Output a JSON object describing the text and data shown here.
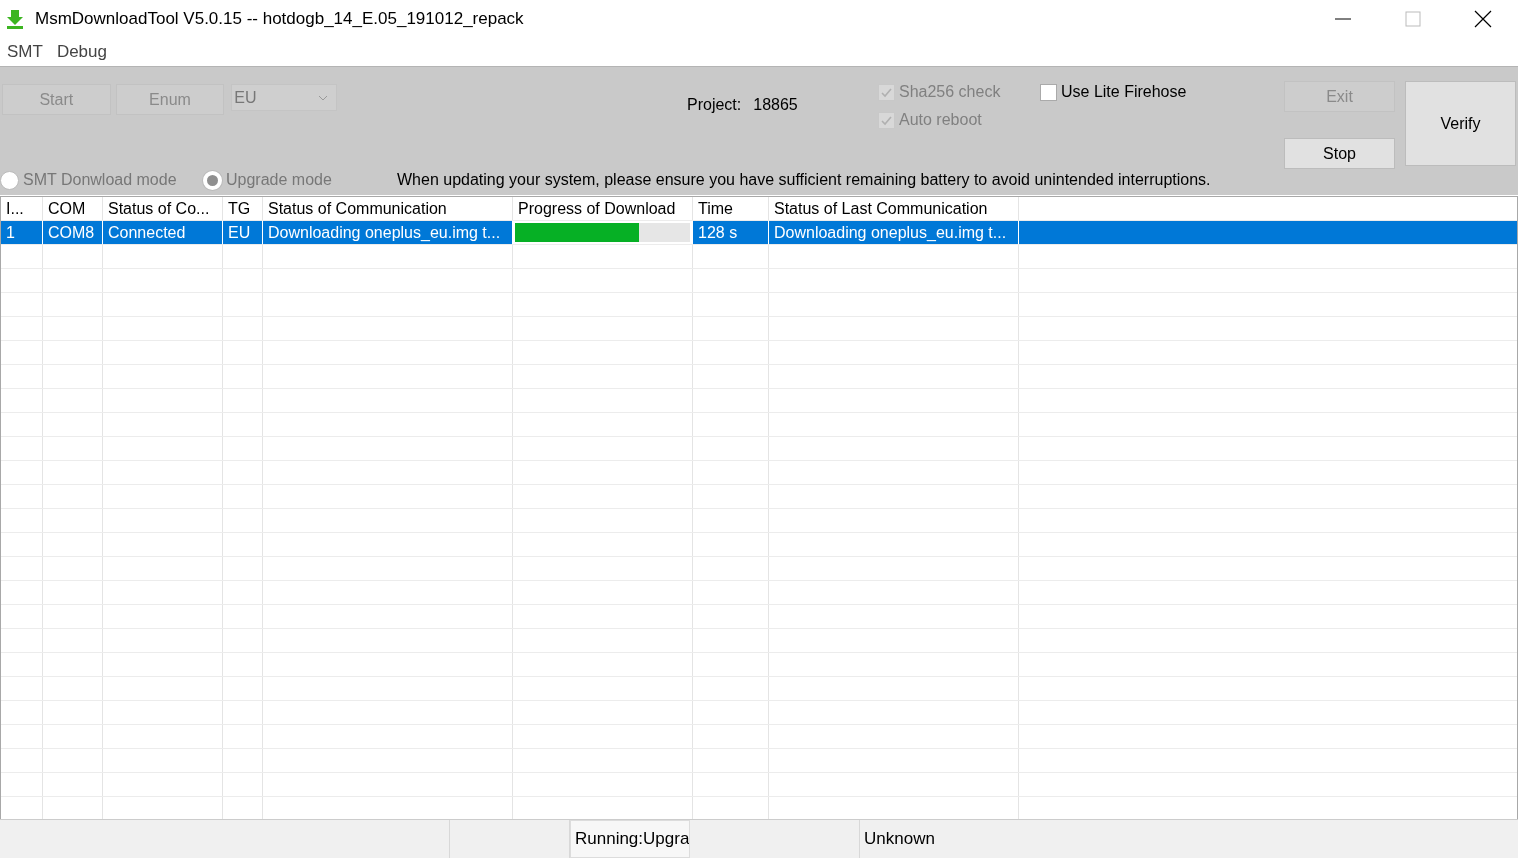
{
  "window": {
    "title": "MsmDownloadTool V5.0.15 -- hotdogb_14_E.05_191012_repack"
  },
  "menu": [
    "SMT",
    "Debug"
  ],
  "toolbar": {
    "buttons": [
      {
        "label": "Start",
        "disabled": true
      },
      {
        "label": "Enum",
        "disabled": true
      }
    ],
    "dropdown": {
      "value": "EU",
      "disabled": true
    },
    "project_label": "Project:",
    "project_value": "18865"
  },
  "checkboxes": [
    {
      "label": "Sha256 check",
      "checked": true,
      "disabled": true
    },
    {
      "label": "Auto reboot",
      "checked": true,
      "disabled": true
    },
    {
      "label": "Use Lite Firehose",
      "checked": false,
      "disabled": false
    }
  ],
  "side_buttons": [
    {
      "label": "Exit",
      "disabled": true
    },
    {
      "label": "Stop",
      "disabled": false
    }
  ],
  "verify_button": {
    "label": "Verify",
    "disabled": false
  },
  "modes": [
    {
      "label": "SMT Donwload mode",
      "selected": false
    },
    {
      "label": "Upgrade mode",
      "selected": true
    }
  ],
  "notice": "When updating your system, please ensure you have sufficient remaining battery to avoid unintended interruptions.",
  "table": {
    "columns": [
      "I...",
      "COM",
      "Status of Co...",
      "TG",
      "Status of Communication",
      "Progress of Download",
      "Time",
      "Status of Last Communication"
    ],
    "rows": [
      {
        "selected": true,
        "cells": [
          "1",
          "COM8",
          "Connected",
          "EU",
          "Downloading oneplus_eu.img t...",
          null,
          "128 s",
          "Downloading oneplus_eu.img t..."
        ],
        "level": 0.71
      }
    ]
  },
  "status_bar": [
    "Running:Upgra",
    "Unknown"
  ]
}
